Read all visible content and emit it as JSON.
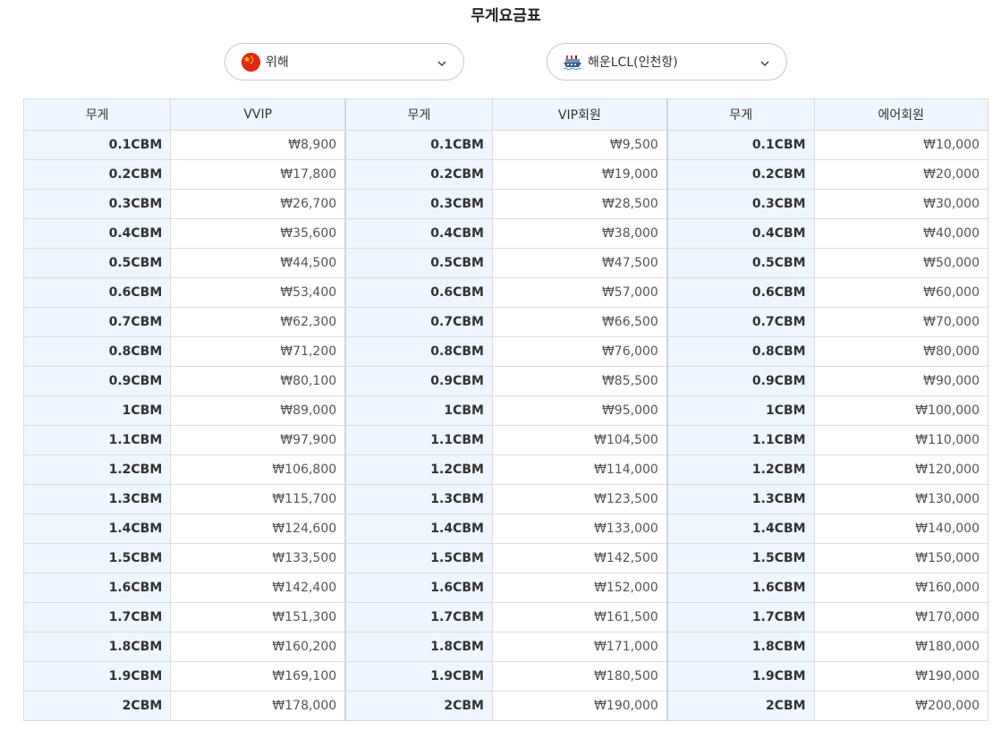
{
  "page": {
    "title": "무게요금표"
  },
  "selectors": {
    "country": {
      "label": "위해",
      "icon": "china-flag-icon"
    },
    "shipping": {
      "label": "해운LCL(인천항)",
      "icon": "ship-icon"
    }
  },
  "colors": {
    "header_bg": "#eef6ff",
    "weight_bg": "#eef6ff",
    "border": "#dcdcdc",
    "flag_red": "#de2910",
    "flag_yellow": "#ffde00"
  },
  "table": {
    "headers": [
      "무게",
      "VVIP",
      "무게",
      "VIP회원",
      "무게",
      "에어회원"
    ],
    "rows": [
      [
        "0.1CBM",
        "₩8,900",
        "0.1CBM",
        "₩9,500",
        "0.1CBM",
        "₩10,000"
      ],
      [
        "0.2CBM",
        "₩17,800",
        "0.2CBM",
        "₩19,000",
        "0.2CBM",
        "₩20,000"
      ],
      [
        "0.3CBM",
        "₩26,700",
        "0.3CBM",
        "₩28,500",
        "0.3CBM",
        "₩30,000"
      ],
      [
        "0.4CBM",
        "₩35,600",
        "0.4CBM",
        "₩38,000",
        "0.4CBM",
        "₩40,000"
      ],
      [
        "0.5CBM",
        "₩44,500",
        "0.5CBM",
        "₩47,500",
        "0.5CBM",
        "₩50,000"
      ],
      [
        "0.6CBM",
        "₩53,400",
        "0.6CBM",
        "₩57,000",
        "0.6CBM",
        "₩60,000"
      ],
      [
        "0.7CBM",
        "₩62,300",
        "0.7CBM",
        "₩66,500",
        "0.7CBM",
        "₩70,000"
      ],
      [
        "0.8CBM",
        "₩71,200",
        "0.8CBM",
        "₩76,000",
        "0.8CBM",
        "₩80,000"
      ],
      [
        "0.9CBM",
        "₩80,100",
        "0.9CBM",
        "₩85,500",
        "0.9CBM",
        "₩90,000"
      ],
      [
        "1CBM",
        "₩89,000",
        "1CBM",
        "₩95,000",
        "1CBM",
        "₩100,000"
      ],
      [
        "1.1CBM",
        "₩97,900",
        "1.1CBM",
        "₩104,500",
        "1.1CBM",
        "₩110,000"
      ],
      [
        "1.2CBM",
        "₩106,800",
        "1.2CBM",
        "₩114,000",
        "1.2CBM",
        "₩120,000"
      ],
      [
        "1.3CBM",
        "₩115,700",
        "1.3CBM",
        "₩123,500",
        "1.3CBM",
        "₩130,000"
      ],
      [
        "1.4CBM",
        "₩124,600",
        "1.4CBM",
        "₩133,000",
        "1.4CBM",
        "₩140,000"
      ],
      [
        "1.5CBM",
        "₩133,500",
        "1.5CBM",
        "₩142,500",
        "1.5CBM",
        "₩150,000"
      ],
      [
        "1.6CBM",
        "₩142,400",
        "1.6CBM",
        "₩152,000",
        "1.6CBM",
        "₩160,000"
      ],
      [
        "1.7CBM",
        "₩151,300",
        "1.7CBM",
        "₩161,500",
        "1.7CBM",
        "₩170,000"
      ],
      [
        "1.8CBM",
        "₩160,200",
        "1.8CBM",
        "₩171,000",
        "1.8CBM",
        "₩180,000"
      ],
      [
        "1.9CBM",
        "₩169,100",
        "1.9CBM",
        "₩180,500",
        "1.9CBM",
        "₩190,000"
      ],
      [
        "2CBM",
        "₩178,000",
        "2CBM",
        "₩190,000",
        "2CBM",
        "₩200,000"
      ]
    ]
  }
}
